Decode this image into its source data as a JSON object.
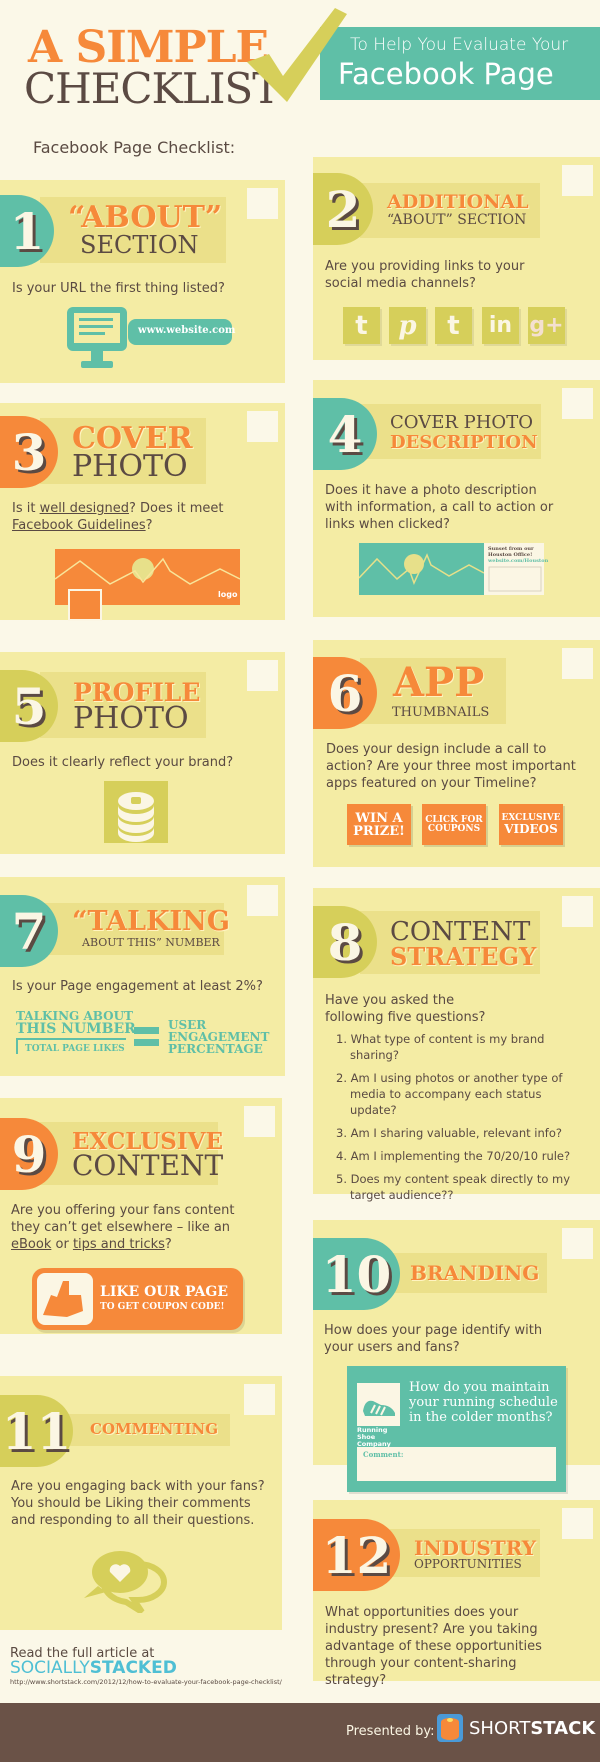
{
  "header": {
    "title_line1": "A SIMPLE",
    "title_line2": "CHECKLIST",
    "subtitle_line1": "To Help You Evaluate Your",
    "subtitle_line2": "Facebook Page",
    "list_title": "Facebook Page Checklist:"
  },
  "colors": {
    "teal": "#5fbfa7",
    "orange": "#f6893a",
    "olive": "#d6cf5a",
    "card_bg": "#f4eca4",
    "page_bg": "#fbf8e8",
    "brown": "#5b4a43",
    "footer_bg": "#6a5247"
  },
  "cards": [
    {
      "number": "1",
      "heading_top": "“ABOUT”",
      "heading_bottom": "SECTION",
      "question": "Is your URL the first thing listed?",
      "illustration": {
        "url_label": "www.website.com"
      }
    },
    {
      "number": "2",
      "heading_top": "ADDITIONAL",
      "heading_bottom": "“ABOUT” SECTION",
      "question": "Are you providing links to your social media channels?",
      "social_icons": [
        {
          "name": "tumblr-icon",
          "glyph": "t"
        },
        {
          "name": "pinterest-icon",
          "glyph": "℘"
        },
        {
          "name": "twitter-icon",
          "glyph": "t"
        },
        {
          "name": "linkedin-icon",
          "glyph": "in"
        },
        {
          "name": "google-plus-icon",
          "glyph": "g+"
        }
      ]
    },
    {
      "number": "3",
      "heading_top": "COVER",
      "heading_bottom": "PHOTO",
      "question_prefix": "Is it ",
      "question_link1": "well designed",
      "question_mid": "? Does it meet ",
      "question_link2": "Facebook Guidelines",
      "question_suffix": "?",
      "illustration": {
        "logo_label": "logo"
      }
    },
    {
      "number": "4",
      "heading_top": "COVER PHOTO",
      "heading_bottom": "DESCRIPTION",
      "question": "Does it have a photo description with information, a call to action or links when clicked?",
      "illustration": {
        "caption_line1": "Sunset from our",
        "caption_line2": "Houston Office!",
        "caption_link": "website.com/Houston"
      }
    },
    {
      "number": "5",
      "heading_top": "PROFILE",
      "heading_bottom": "PHOTO",
      "question": "Does it clearly reflect your brand?"
    },
    {
      "number": "6",
      "heading_top": "APP",
      "heading_bottom": "THUMBNAILS",
      "question": "Does your design include a call to action? Are your three most important apps featured on your Timeline?",
      "app_buttons": [
        {
          "line1": "WIN A",
          "line2": "PRIZE!"
        },
        {
          "line1": "CLICK FOR",
          "line2": "COUPONS"
        },
        {
          "line1": "EXCLUSIVE",
          "line2": "VIDEOS"
        }
      ]
    },
    {
      "number": "7",
      "heading_top": "“TALKING",
      "heading_bottom": "ABOUT THIS” NUMBER",
      "question": "Is your Page engagement at least 2%?",
      "formula": {
        "numerator_line1": "TALKING ABOUT",
        "numerator_line2": "THIS NUMBER",
        "denominator": "TOTAL PAGE LIKES",
        "result_line1": "USER",
        "result_line2": "ENGAGEMENT",
        "result_line3": "PERCENTAGE"
      }
    },
    {
      "number": "8",
      "heading_top": "CONTENT",
      "heading_bottom": "STRATEGY",
      "question": "Have you asked the following five questions?",
      "sub_questions": [
        "1. What type of content is my brand sharing?",
        "2. Am I using photos or another type of media to accompany each status update?",
        "3. Am I sharing valuable, relevant info?",
        "4. Am I implementing the 70/20/10 rule?",
        "5. Does my content speak directly to my target audience??"
      ]
    },
    {
      "number": "9",
      "heading_top": "EXCLUSIVE",
      "heading_bottom": "CONTENT",
      "question_prefix": "Are you offering your  fans content they can’t get elsewhere – like an ",
      "question_link1": "eBook",
      "question_mid": " or ",
      "question_link2": "tips and tricks",
      "question_suffix": "?",
      "like_button": {
        "line1": "LIKE OUR PAGE",
        "line2": "TO GET COUPON CODE!"
      }
    },
    {
      "number": "10",
      "heading": "BRANDING",
      "question": "How does your page identify with your users and fans?",
      "post": {
        "brand_name": "Running Shoe Company",
        "text": "How do you maintain your running schedule in the colder months?",
        "comment_label": "Comment:"
      }
    },
    {
      "number": "11",
      "heading": "COMMENTING",
      "question": "Are you engaging back with your fans? You should be Liking their comments and responding to all their questions."
    },
    {
      "number": "12",
      "heading_top": "INDUSTRY",
      "heading_bottom": "OPPORTUNITIES",
      "question": "What opportunities does your industry present? Are you taking advantage of these opportunities through your content-sharing strategy?"
    }
  ],
  "source": {
    "read_more": "Read the full article at",
    "brand_light": "SOCIALLY",
    "brand_bold": "STACKED",
    "url": "http://www.shortstack.com/2012/12/how-to-evaluate-your-facebook-page-checklist/"
  },
  "footer": {
    "presented_by": "Presented by:",
    "logo_light": "SHORT",
    "logo_bold": "STACK"
  }
}
